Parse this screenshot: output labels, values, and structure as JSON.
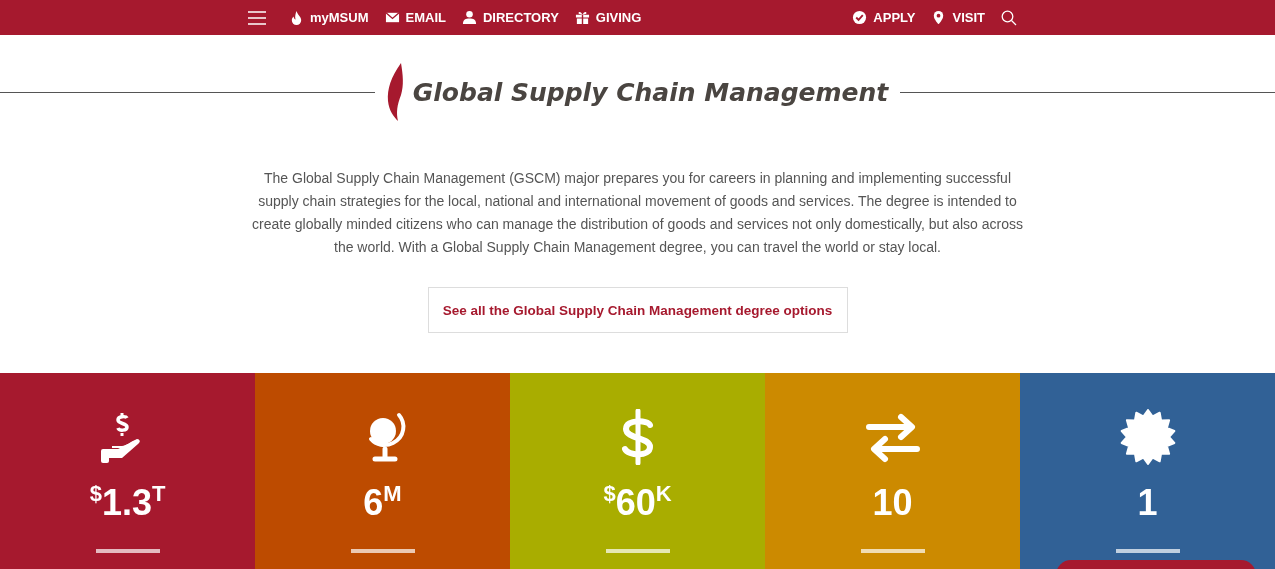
{
  "nav": {
    "left": [
      {
        "kind": "flame",
        "label": "myMSUM"
      },
      {
        "kind": "mail",
        "label": "EMAIL"
      },
      {
        "kind": "person",
        "label": "DIRECTORY"
      },
      {
        "kind": "gift",
        "label": "GIVING"
      }
    ],
    "right": [
      {
        "kind": "check",
        "label": "APPLY"
      },
      {
        "kind": "pin",
        "label": "VISIT"
      }
    ]
  },
  "heading": "Global Supply Chain Management",
  "intro": "The Global Supply Chain Management (GSCM) major prepares you for careers in planning and implementing successful supply chain strategies for the local, national and international movement of goods and services. The degree is intended to create globally minded citizens who can manage the distribution of goods and services not only domestically, but also across the world. With a Global Supply Chain Management degree, you can travel the world or stay local.",
  "cta": "See all the Global Supply Chain Management degree options",
  "stats": [
    {
      "kind": "hand",
      "color": "#a6192e",
      "prefix": "$",
      "number": "1.3",
      "suffix": "T"
    },
    {
      "kind": "globe",
      "color": "#bd4b00",
      "number": "6",
      "suffix": "M"
    },
    {
      "kind": "dollar",
      "color": "#a9ad00",
      "prefix": "$",
      "number": "60",
      "suffix": "K"
    },
    {
      "kind": "arrows",
      "color": "#cc8a00",
      "number": "10"
    },
    {
      "kind": "badge",
      "color": "#316196",
      "number": "1"
    }
  ]
}
